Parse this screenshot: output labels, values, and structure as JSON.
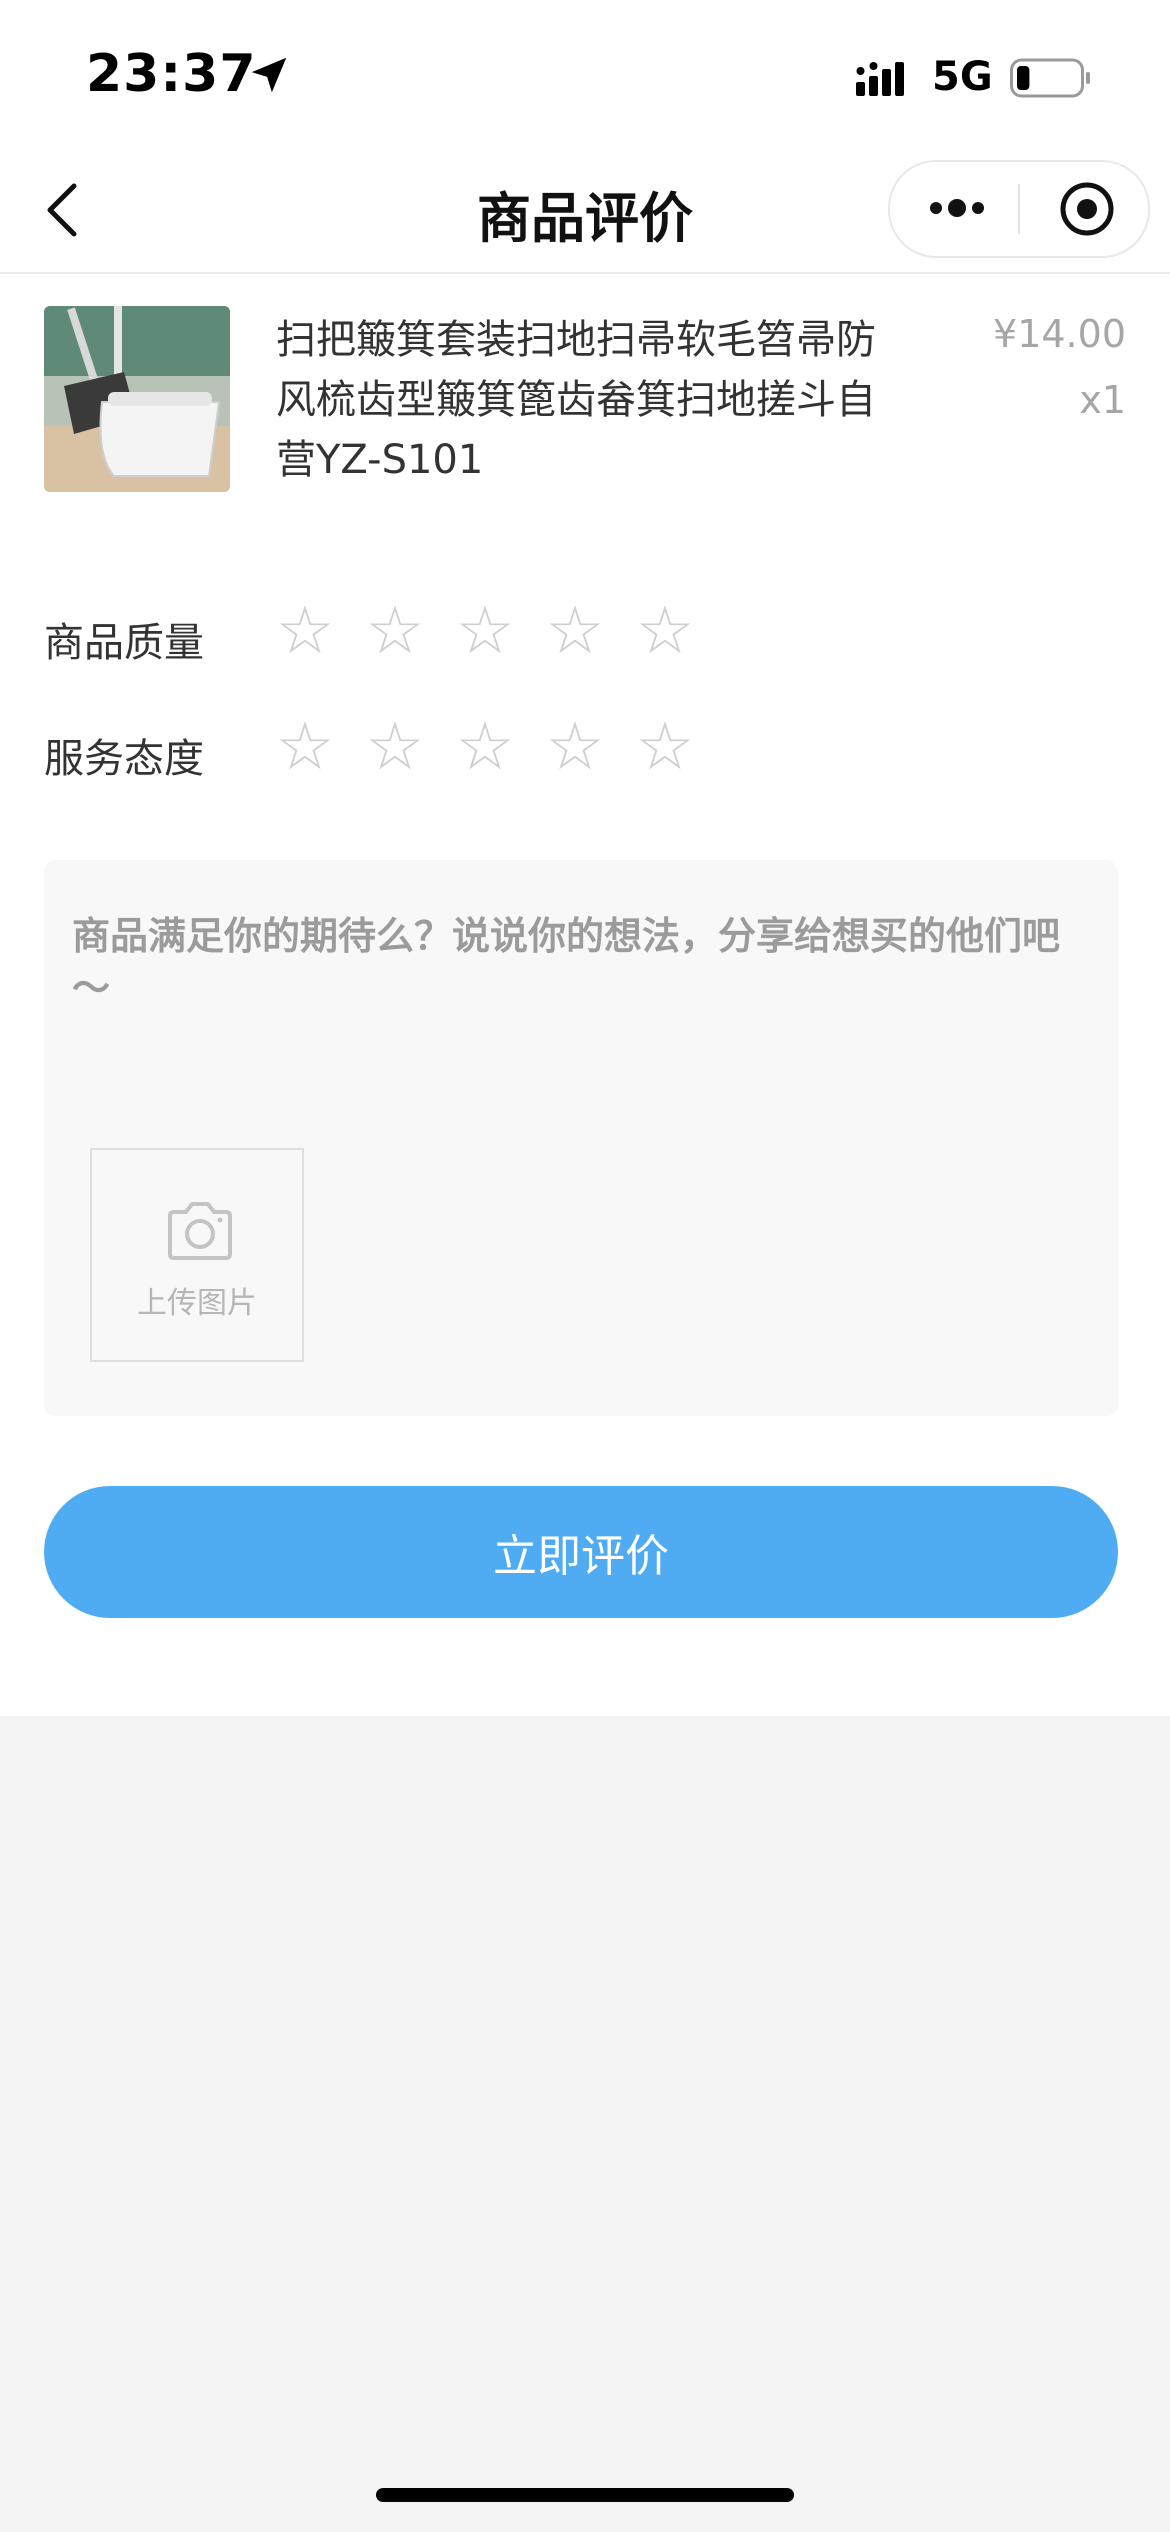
{
  "status_bar": {
    "time": "23:37",
    "network": "5G",
    "battery_level": 0.2
  },
  "nav": {
    "title": "商品评价"
  },
  "product": {
    "name": "扫把簸箕套装扫地扫帚软毛笤帚防风梳齿型簸箕篦齿畚箕扫地搓斗自营YZ-S101",
    "price": "¥14.00",
    "quantity": "x1"
  },
  "ratings": [
    {
      "label": "商品质量",
      "stars": 0,
      "max_stars": 5
    },
    {
      "label": "服务态度",
      "stars": 0,
      "max_stars": 5
    }
  ],
  "review": {
    "value": "",
    "placeholder": "商品满足你的期待么？说说你的想法，分享给想买的他们吧～",
    "upload_label": "上传图片"
  },
  "submit": {
    "label": "立即评价"
  },
  "colors": {
    "accent": "#4facf2",
    "star_empty": "#cfcfcf",
    "background": "#f4f4f4"
  }
}
